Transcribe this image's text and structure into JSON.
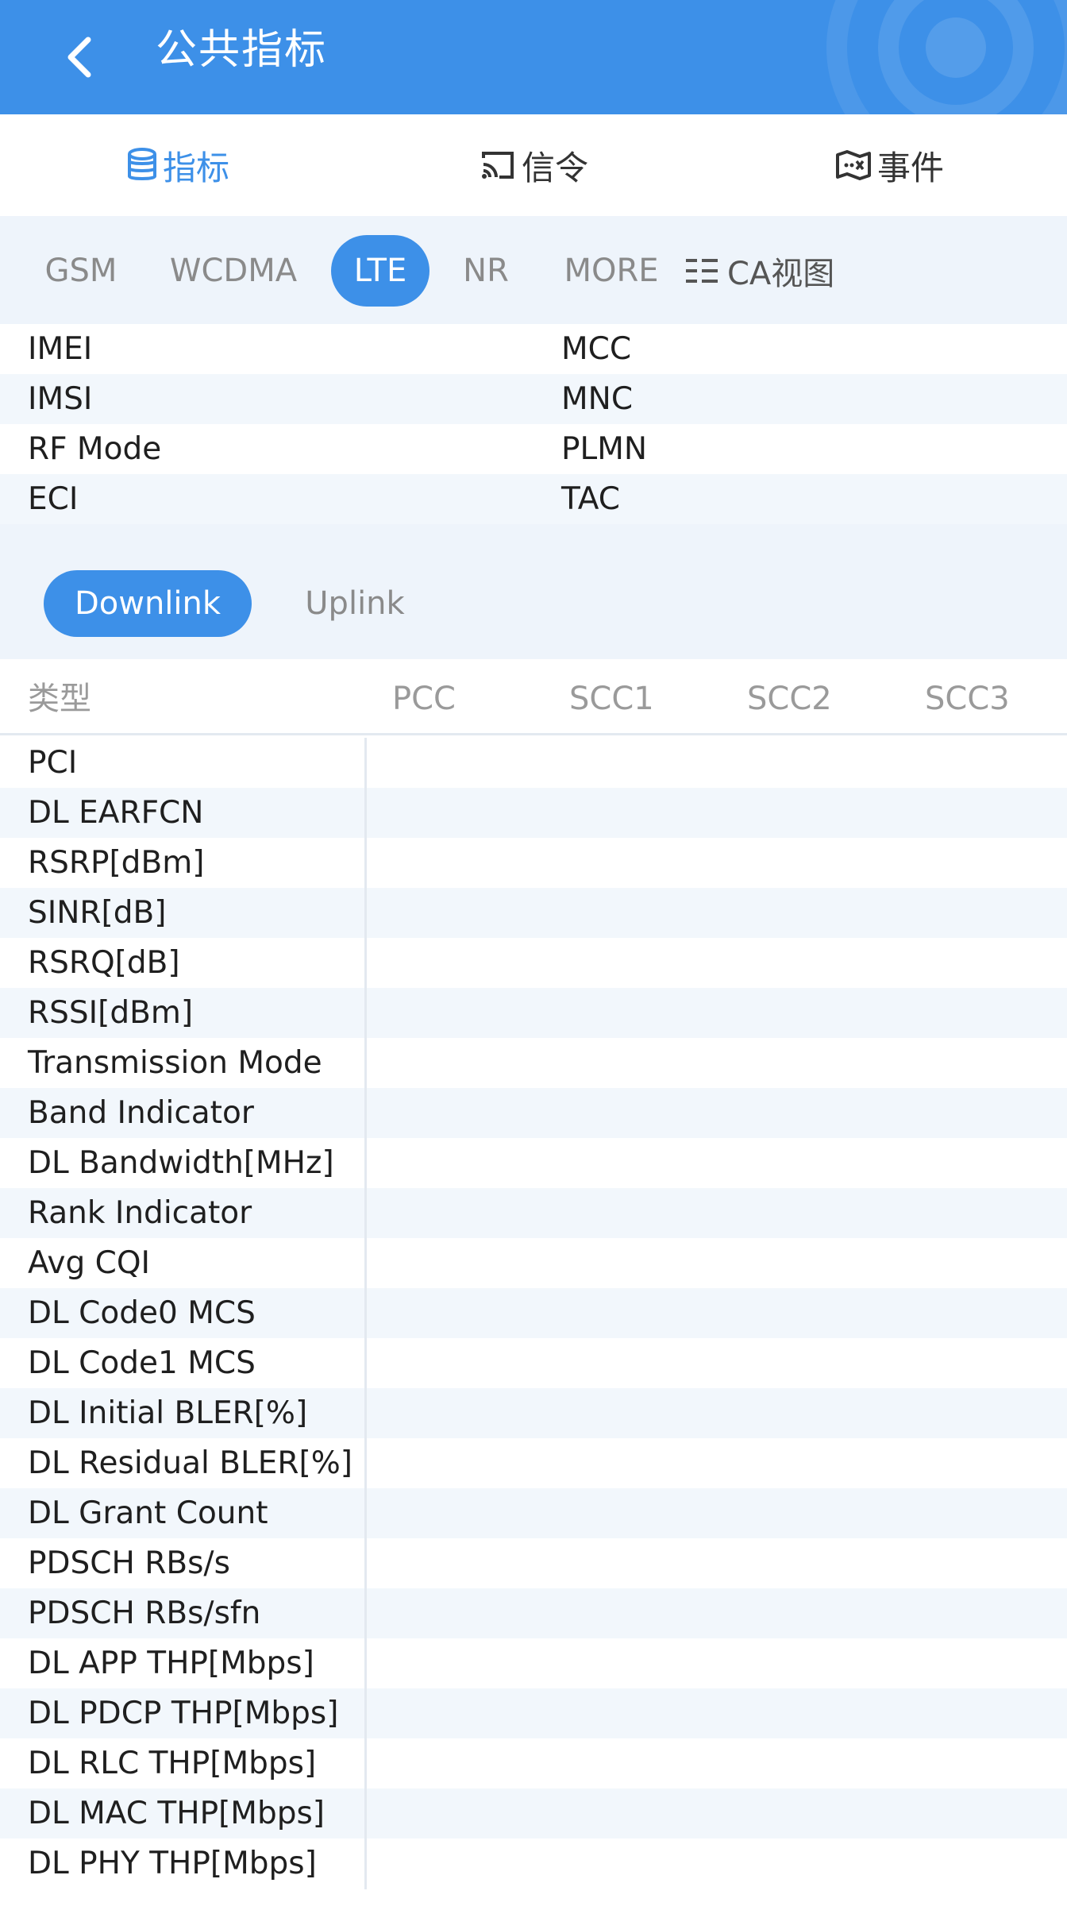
{
  "header": {
    "title": "公共指标"
  },
  "main_tabs": [
    {
      "label": "指标",
      "icon": "database-icon",
      "active": true
    },
    {
      "label": "信令",
      "icon": "cast-icon",
      "active": false
    },
    {
      "label": "事件",
      "icon": "map-event-icon",
      "active": false
    }
  ],
  "tech_tabs": [
    {
      "label": "GSM"
    },
    {
      "label": "WCDMA"
    },
    {
      "label": "LTE"
    },
    {
      "label": "NR"
    },
    {
      "label": "MORE"
    }
  ],
  "ca_view": {
    "label": "CA视图",
    "icon": "list-icon"
  },
  "info": {
    "rows": [
      {
        "left": "IMEI",
        "right": "MCC"
      },
      {
        "left": "IMSI",
        "right": "MNC"
      },
      {
        "left": "RF Mode",
        "right": "PLMN"
      },
      {
        "left": "ECI",
        "right": "TAC"
      }
    ]
  },
  "link_toggle": {
    "downlink": "Downlink",
    "uplink": "Uplink"
  },
  "table": {
    "columns": [
      "类型",
      "PCC",
      "SCC1",
      "SCC2",
      "SCC3"
    ],
    "rows": [
      "PCI",
      "DL EARFCN",
      "RSRP[dBm]",
      "SINR[dB]",
      "RSRQ[dB]",
      "RSSI[dBm]",
      "Transmission Mode",
      "Band Indicator",
      "DL Bandwidth[MHz]",
      "Rank Indicator",
      "Avg CQI",
      "DL Code0 MCS",
      "DL Code1 MCS",
      "DL Initial BLER[%]",
      "DL Residual BLER[%]",
      "DL Grant Count",
      "PDSCH RBs/s",
      "PDSCH RBs/sfn",
      "DL APP THP[Mbps]",
      "DL PDCP THP[Mbps]",
      "DL RLC THP[Mbps]",
      "DL MAC THP[Mbps]",
      "DL PHY THP[Mbps]"
    ]
  },
  "colors": {
    "accent": "#3d90e8",
    "band_background": "#eef4fb",
    "row_stripe": "#f2f7fc"
  }
}
